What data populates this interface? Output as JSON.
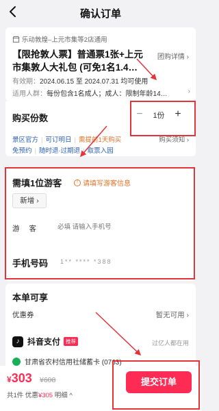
{
  "header": {
    "title": "确认订单"
  },
  "product": {
    "merchant": "乐动敦煌–上元市集等2店通用",
    "title": "【限抢敦人票】普通票1张+上元市集敦人大礼包 (可免1名1.4…",
    "detail_link": "团购详情 ›",
    "valid_label": "有效期：",
    "valid_value": "2024.06.15 至 2024.07.31 均可使用",
    "people_label": "适用人群：",
    "people_value": "每份包含1名成人；成人：限制年龄14…",
    "people_arrow": "›"
  },
  "quantity": {
    "label": "购买份数",
    "minus": "−",
    "value": "1份",
    "plus": "+",
    "tags_row1": [
      "景区官方",
      "可订明日",
      "需提前1天购买"
    ],
    "notice": "购买须知 ›",
    "tags_row2": [
      "免预约",
      "随时退·过期退",
      "取票入园"
    ]
  },
  "visitor": {
    "label": "需填1位游客",
    "warn": "请填写游客信息",
    "warn_icon": "!",
    "add_button": "新增 ›",
    "guest_label": "游客",
    "guest_placeholder": "必填 请输入手机号",
    "phone_label": "手机号码",
    "phone_value": "1** **** *388"
  },
  "discount": {
    "title": "本单可享",
    "coupon_label": "优惠券",
    "coupon_value": "暂无可用 ›"
  },
  "payment": {
    "logo": "♪",
    "name": "抖音支付",
    "badge": "推荐",
    "note": "过亿人都在用",
    "cut_text": "甘肃省农村信用社储蓄卡 (0763)"
  },
  "bottom": {
    "currency": "¥",
    "price": "303",
    "original_price": "¥608",
    "summary_prefix": "共1件 优惠",
    "summary_discount": "¥305",
    "summary_suffix": " 明细 ^",
    "submit": "提交订单"
  },
  "colors": {
    "accent": "#fe2c55",
    "annotation": "#e5333a",
    "link": "#2b5fb3",
    "warn": "#e0732a"
  }
}
